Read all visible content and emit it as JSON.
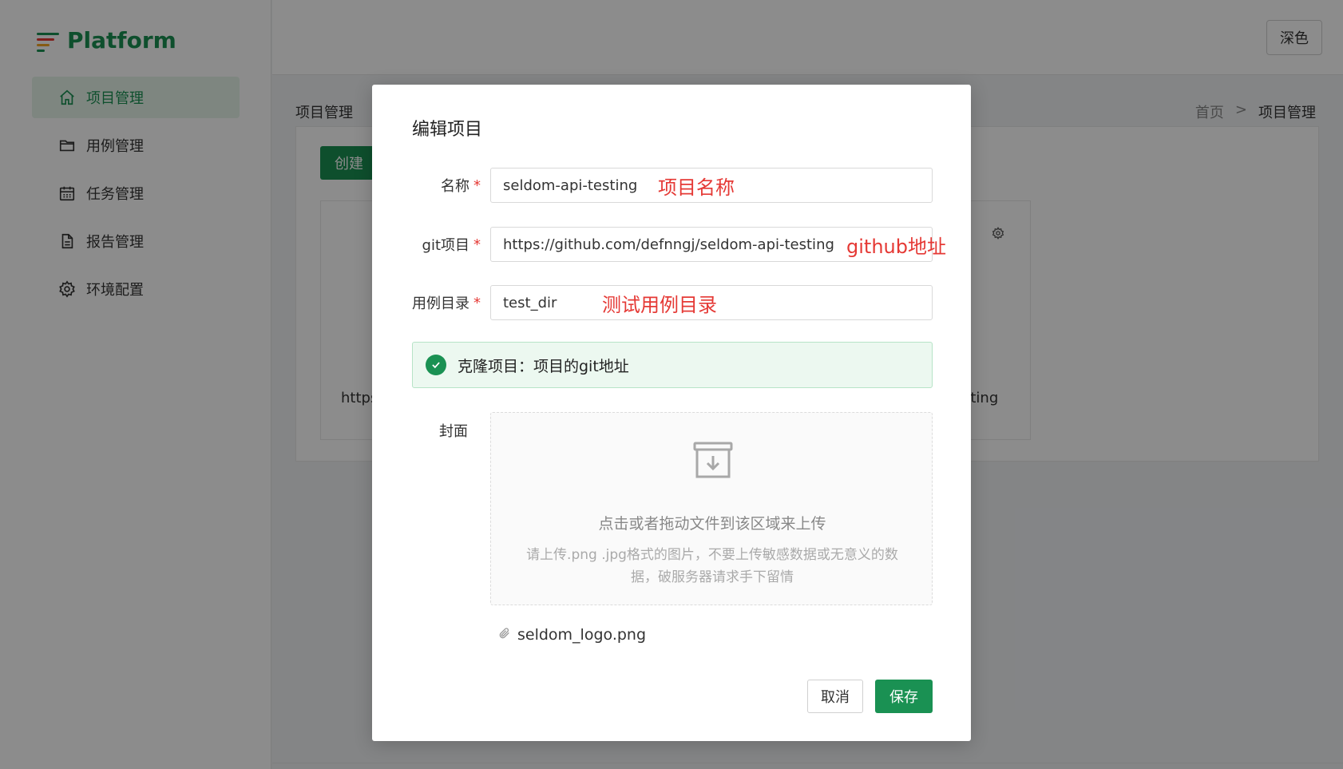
{
  "app": {
    "title": "Platform",
    "theme_button": "深色"
  },
  "sidebar": {
    "items": [
      {
        "label": "项目管理",
        "icon": "home-icon",
        "active": true
      },
      {
        "label": "用例管理",
        "icon": "folder-icon",
        "active": false
      },
      {
        "label": "任务管理",
        "icon": "calendar-icon",
        "active": false
      },
      {
        "label": "报告管理",
        "icon": "document-icon",
        "active": false
      },
      {
        "label": "环境配置",
        "icon": "gear-icon",
        "active": false
      }
    ]
  },
  "page": {
    "title": "项目管理",
    "breadcrumb": [
      "首页",
      ">",
      "项目管理"
    ],
    "create_button": "创建",
    "card_url_left": "https",
    "card_url_right": "sting"
  },
  "modal": {
    "title": "编辑项目",
    "fields": [
      {
        "label": "名称",
        "required": true,
        "value": "seldom-api-testing",
        "annotation": "项目名称"
      },
      {
        "label": "git项目",
        "required": true,
        "value": "https://github.com/defnngj/seldom-api-testing",
        "annotation": "github地址"
      },
      {
        "label": "用例目录",
        "required": true,
        "value": "test_dir",
        "annotation": "测试用例目录"
      }
    ],
    "required_mark": "*",
    "alert": "克隆项目：项目的git地址",
    "cover_label": "封面",
    "upload_text": "点击或者拖动文件到该区域来上传",
    "upload_hint": "请上传.png .jpg格式的图片，不要上传敏感数据或无意义的数据，破服务器请求手下留情",
    "file_name": "seldom_logo.png",
    "cancel_button": "取消",
    "save_button": "保存"
  },
  "colors": {
    "accent": "#1a9153",
    "annotation": "#e53935",
    "alert_bg": "#ecf8f0"
  }
}
